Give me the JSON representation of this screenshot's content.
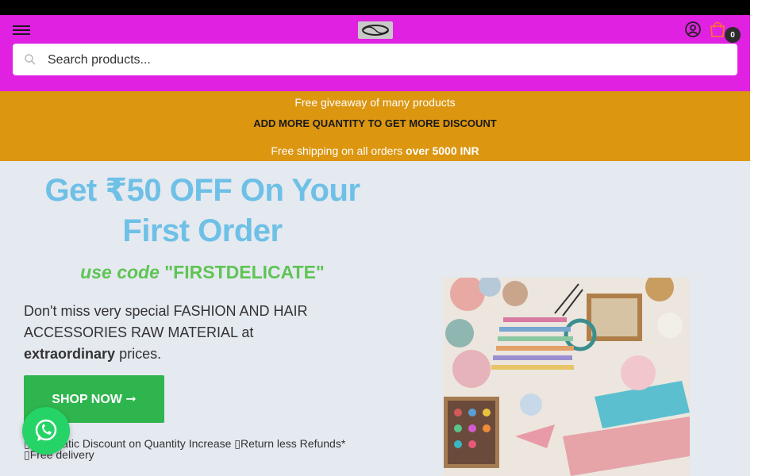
{
  "header": {
    "search_placeholder": "Search products...",
    "cart_count": "0",
    "background_color": "#e021e2"
  },
  "promo": {
    "line1": "Free giveaway of many products",
    "line2": "ADD MORE QUANTITY TO GET MORE DISCOUNT",
    "line3_prefix": "Free  shipping on all orders ",
    "line3_bold": "over 5000 INR",
    "background_color": "#dc9610"
  },
  "hero": {
    "title": "Get ₹50 OFF On Your First Order",
    "code_prefix": "use code ",
    "code_value": "\"FIRSTDELICATE\"",
    "description_prefix": "Don't miss very special FASHION AND HAIR ACCESSORIES RAW MATERIAL at ",
    "description_bold": "extraordinary",
    "description_suffix": " prices.",
    "button_label": "SHOP NOW ➞",
    "features": [
      "▯Automatic Discount on Quantity Increase",
      "▯Return less Refunds*",
      "▯Free delivery"
    ]
  },
  "icons": {
    "menu": "hamburger-menu-icon",
    "logo": "logo",
    "account": "account-icon",
    "cart": "shopping-bag-icon",
    "search": "search-icon",
    "whatsapp": "whatsapp-icon"
  }
}
